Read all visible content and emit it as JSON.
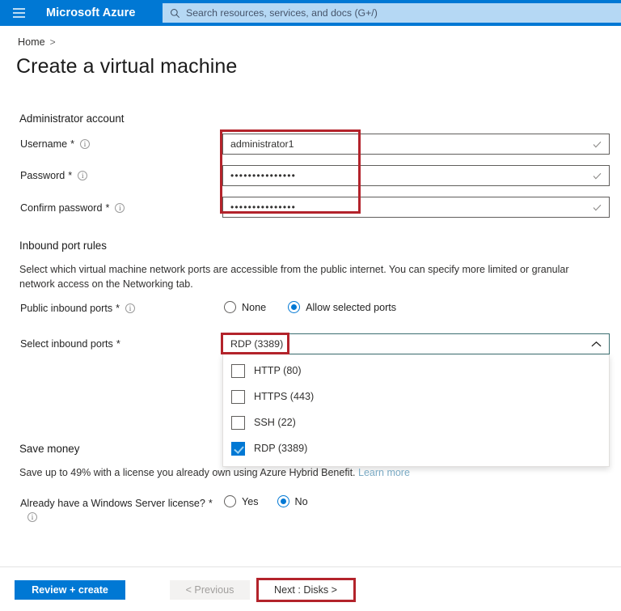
{
  "header": {
    "menu_icon": "hamburger-icon",
    "brand": "Microsoft Azure",
    "search_icon": "search-icon",
    "search_placeholder": "Search resources, services, and docs (G+/)",
    "bar_color": "#0078d4",
    "search_bg": "#b5d8f4"
  },
  "breadcrumb": {
    "home": "Home",
    "separator": ">"
  },
  "page": {
    "title": "Create a virtual machine"
  },
  "admin_section": {
    "heading": "Administrator account",
    "fields": [
      {
        "label": "Username",
        "required": "*",
        "info_icon": "info-icon",
        "value": "administrator1",
        "type": "text",
        "valid_icon": "checkmark-icon"
      },
      {
        "label": "Password",
        "required": "*",
        "info_icon": "info-icon",
        "value": "•••••••••••••••",
        "type": "password",
        "valid_icon": "checkmark-icon"
      },
      {
        "label": "Confirm password",
        "required": "*",
        "info_icon": "info-icon",
        "value": "•••••••••••••••",
        "type": "password",
        "valid_icon": "checkmark-icon"
      }
    ]
  },
  "inbound_section": {
    "heading": "Inbound port rules",
    "description": "Select which virtual machine network ports are accessible from the public internet. You can specify more limited or granular network access on the Networking tab.",
    "public_ports_label": "Public inbound ports",
    "public_ports_required": "*",
    "public_ports_info": "info-icon",
    "options": [
      {
        "label": "None",
        "selected": false
      },
      {
        "label": "Allow selected ports",
        "selected": true
      }
    ],
    "select_ports_label": "Select inbound ports",
    "select_ports_required": "*",
    "selected_value": "RDP (3389)",
    "chevron_icon": "chevron-up-icon",
    "port_options": [
      {
        "label": "HTTP (80)",
        "checked": false
      },
      {
        "label": "HTTPS (443)",
        "checked": false
      },
      {
        "label": "SSH (22)",
        "checked": false
      },
      {
        "label": "RDP (3389)",
        "checked": true
      }
    ]
  },
  "save_money_section": {
    "heading": "Save money",
    "description_prefix": "Save up to 49% with a license you already own using Azure Hybrid Benefit.",
    "learn_more": "Learn more",
    "license_label": "Already have a Windows Server license?",
    "license_required": "*",
    "license_info": "info-icon",
    "license_options": [
      {
        "label": "Yes",
        "selected": false
      },
      {
        "label": "No",
        "selected": true
      }
    ]
  },
  "footer": {
    "review_create": "Review + create",
    "previous": "< Previous",
    "next": "Next : Disks >"
  },
  "annotations": {
    "color": "#b3232b",
    "boxes": [
      "admin-fields-highlight",
      "selected-port-highlight",
      "next-button-highlight"
    ]
  }
}
